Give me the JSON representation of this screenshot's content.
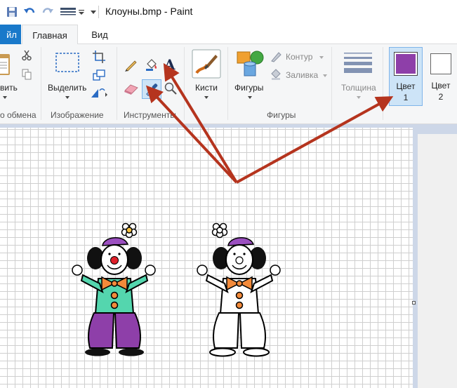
{
  "window": {
    "title": "Клоуны.bmp - Paint"
  },
  "tabs": {
    "file": "йл",
    "home": "Главная",
    "view": "Вид"
  },
  "groups": {
    "clipboard": {
      "label": "о обмена",
      "paste_label": "вить"
    },
    "image": {
      "label": "Изображение",
      "select_label": "Выделить"
    },
    "tools": {
      "label": "Инструменты"
    },
    "brushes": {
      "label": "Кисти"
    },
    "shapes": {
      "label": "Фигуры",
      "shapes_label": "Фигуры",
      "outline_label": "Контур",
      "fill_label": "Заливка"
    },
    "size": {
      "label": "Толщина"
    },
    "colors": {
      "color1_label_line1": "Цвет",
      "color1_label_line2": "1",
      "color2_label_line1": "Цвет",
      "color2_label_line2": "2"
    }
  },
  "colors": {
    "color1": "#8e3fa9",
    "color2": "#ffffff",
    "accent": "#1979ca",
    "arrow": "#b5341e"
  },
  "icons": [
    "save-icon",
    "undo-icon",
    "redo-icon",
    "customize-qat-icon",
    "cut-icon",
    "copy-icon",
    "crop-icon",
    "resize-icon",
    "rotate-icon",
    "pencil-icon",
    "fill-bucket-icon",
    "text-icon",
    "eraser-icon",
    "color-picker-icon",
    "magnifier-icon",
    "brushes-icon",
    "shapes-icon",
    "outline-icon",
    "fill-icon",
    "line-size-icon"
  ]
}
